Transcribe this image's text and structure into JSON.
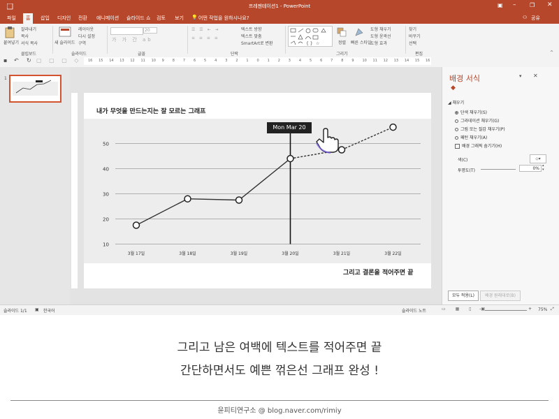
{
  "window": {
    "title": "프레젠테이션1 - PowerPoint"
  },
  "tabs": [
    "파일",
    "홈",
    "삽입",
    "디자인",
    "전환",
    "애니메이션",
    "슬라이드 쇼",
    "검토",
    "보기"
  ],
  "tell_me": "어떤 작업을 원하시나요?",
  "share": "공유",
  "ribbon": {
    "clipboard": {
      "label": "클립보드",
      "paste": "붙여넣기",
      "cut": "잘라내기",
      "copy": "복사",
      "format_painter": "서식 복사"
    },
    "slides": {
      "label": "슬라이드",
      "new_slide": "새 슬라이드",
      "layout": "레이아웃",
      "reset": "다시 설정",
      "section": "구역"
    },
    "font": {
      "label": "글꼴",
      "size": "20"
    },
    "paragraph": {
      "label": "단락",
      "text_direction": "텍스트 방향",
      "align_text": "텍스트 맞춤",
      "smartart": "SmartArt로 변환"
    },
    "drawing": {
      "label": "그리기",
      "arrange": "정렬",
      "quick_styles": "빠른 스타일",
      "fill": "도형 채우기",
      "outline": "도형 윤곽선",
      "effects": "도형 효과"
    },
    "editing": {
      "label": "편집",
      "find": "찾기",
      "replace": "바꾸기",
      "select": "선택"
    }
  },
  "ruler": [
    "16",
    "15",
    "14",
    "13",
    "12",
    "11",
    "10",
    "9",
    "8",
    "7",
    "6",
    "5",
    "4",
    "3",
    "2",
    "1",
    "0",
    "1",
    "2",
    "3",
    "4",
    "5",
    "6",
    "7",
    "8",
    "9",
    "10",
    "11",
    "12",
    "13",
    "14",
    "15",
    "16"
  ],
  "slide_panel": {
    "slide_number": "1"
  },
  "slide": {
    "title": "내가 무엇을 만드는지는 잘 모르는 그래프",
    "conclusion": "그리고 결론을 적어주면 끝",
    "tooltip": "Mon Mar 20"
  },
  "chart_data": {
    "type": "line",
    "categories": [
      "3월 17일",
      "3월 18일",
      "3월 19일",
      "3월 20일",
      "3월 21일",
      "3월 22일"
    ],
    "series": [
      {
        "x": [
          0,
          1,
          2,
          3
        ],
        "values": [
          17.5,
          28,
          27.5,
          44
        ],
        "style": "solid"
      },
      {
        "x": [
          3,
          4,
          5
        ],
        "values": [
          44,
          47.5,
          56.5
        ],
        "style": "dashed"
      }
    ],
    "yticks": [
      10,
      20,
      30,
      40,
      50
    ],
    "ylim": [
      10,
      60
    ],
    "grid": true,
    "colors": {
      "plot_bg": "#ededed",
      "line": "#333333"
    }
  },
  "format_pane": {
    "title": "배경 서식",
    "section": "채우기",
    "options": [
      "단색 채우기(S)",
      "그라데이션 채우기(G)",
      "그림 또는 질감 채우기(P)",
      "패턴 채우기(A)"
    ],
    "hide_bg": "배경 그래픽 숨기기(H)",
    "color_label": "색(C)",
    "transparency_label": "투명도(T)",
    "transparency_value": "0%",
    "apply_all": "모두 적용(L)",
    "reset_bg": "배경 원래대로(B)"
  },
  "status": {
    "slide": "슬라이드 1/1",
    "language": "한국어",
    "notes": "슬라이드 노트",
    "zoom": "75%"
  },
  "caption": {
    "line1": "그리고 남은 여백에 텍스트를 적어주면 끝",
    "line2": "간단하면서도 예쁜 꺾은선 그래프 완성 !"
  },
  "footer": "윤피티연구소 @ blog.naver.com/rimiy"
}
